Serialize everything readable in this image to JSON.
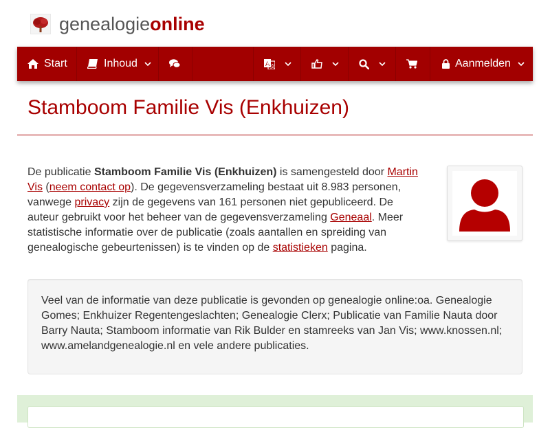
{
  "logo": {
    "text_plain": "genealogie",
    "text_bold": "online"
  },
  "nav": {
    "start_label": "Start",
    "content_label": "Inhoud",
    "login_label": "Aanmelden"
  },
  "page": {
    "title": "Stamboom Familie Vis (Enkhuizen)"
  },
  "intro": {
    "t1": "De publicatie ",
    "pub_name": "Stamboom Familie Vis (Enkhuizen)",
    "t2": " is samengesteld door ",
    "author_link": "Martin Vis",
    "t3": " (",
    "contact_link": "neem contact op",
    "t4": "). De gegevensverzameling bestaat uit 8.983 personen, vanwege ",
    "privacy_link": "privacy",
    "t5": " zijn de gegevens van 161 personen niet gepubliceerd. De auteur gebruikt voor het beheer van de gegevensverzameling ",
    "software_link": "Geneaal",
    "t6": ". Meer statistische informatie over de publicatie (zoals aantallen en spreiding van genealogische gebeurtenissen) is te vinden op de ",
    "stats_link": "statistieken",
    "t7": " pagina."
  },
  "sources": {
    "text": "Veel van de informatie van deze publicatie is gevonden op genealogie online:oa. Genealogie Gomes; Enkhuizer Regentengeslachten; Genealogie Clerx; Publicatie van Familie Nauta door Barry Nauta; Stamboom informatie van Rik Bulder en stamreeks van Jan Vis; www.knossen.nl; www.amelandgenealogie.nl en vele andere publicaties."
  },
  "icons": {
    "home": "home-icon",
    "book": "book-icon",
    "chat": "comments-icon",
    "translate": "translate-icon",
    "hand": "hand-pointer-icon",
    "search": "search-icon",
    "cart": "cart-icon",
    "lock": "lock-icon",
    "chevron": "chevron-down-icon",
    "avatar": "user-silhouette-icon"
  },
  "colors": {
    "brand": "#a20000",
    "title": "#a80000",
    "panel_green": "#dff0d8"
  }
}
